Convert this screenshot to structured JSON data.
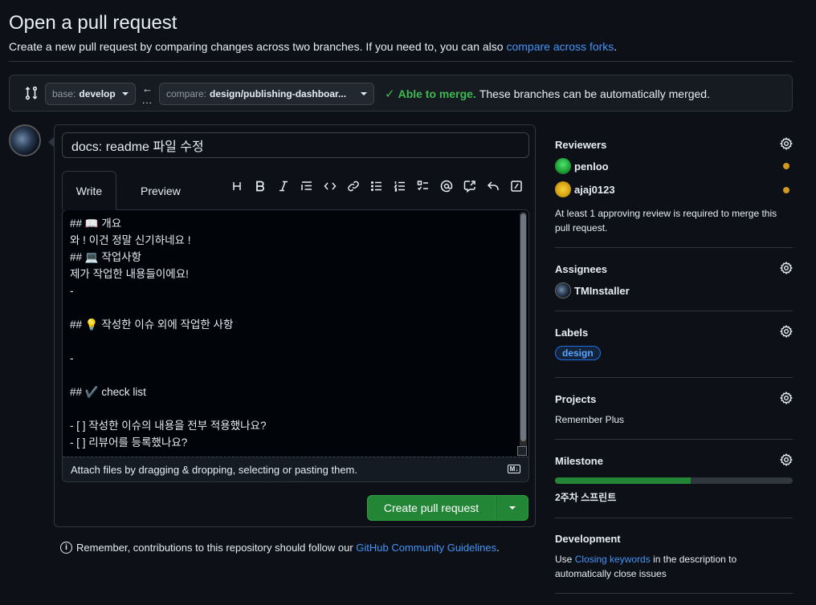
{
  "header": {
    "title": "Open a pull request",
    "subtitle": "Create a new pull request by comparing changes across two branches. If you need to, you can also ",
    "subtitle_link": "compare across forks",
    "subtitle_end": "."
  },
  "branches": {
    "base_key": "base:",
    "base_value": "develop",
    "compare_key": "compare:",
    "compare_value": "design/publishing-dashboar...",
    "arrow": "←",
    "dots": "...",
    "merge_ok": "Able to merge.",
    "merge_text": "These branches can be automatically merged."
  },
  "form": {
    "title_value": "docs: readme 파일 수정",
    "tabs": {
      "write": "Write",
      "preview": "Preview"
    },
    "body": "## 📖 개요\n와 ! 이건 정말 신기하네요 !\n## 💻 작업사항\n제가 작업한 내용들이에요!\n-\n\n## 💡 작성한 이슈 외에 작업한 사항\n\n-\n\n## ✔️ check list\n\n- [ ] 작성한 이슈의 내용을 전부 적용했나요?\n- [ ] 리뷰어를 등록했나요?",
    "attach_text": "Attach files by dragging & dropping, selecting or pasting them.",
    "create_label": "Create pull request"
  },
  "guidelines": {
    "prefix": "Remember, contributions to this repository should follow our ",
    "link": "GitHub Community Guidelines",
    "suffix": "."
  },
  "sidebar": {
    "reviewers": {
      "heading": "Reviewers",
      "items": [
        {
          "name": "penloo",
          "status_color": "#d29922"
        },
        {
          "name": "ajaj0123",
          "status_color": "#d29922"
        }
      ],
      "note": "At least 1 approving review is required to merge this pull request."
    },
    "assignees": {
      "heading": "Assignees",
      "name": "TMInstaller"
    },
    "labels": {
      "heading": "Labels",
      "label": "design"
    },
    "projects": {
      "heading": "Projects",
      "value": "Remember Plus"
    },
    "milestone": {
      "heading": "Milestone",
      "progress": 0.57,
      "name": "2주차 스프린트"
    },
    "development": {
      "heading": "Development",
      "prefix": "Use ",
      "link": "Closing keywords",
      "suffix": " in the description to automatically close issues"
    }
  },
  "colors": {
    "accent": "#4493f8",
    "success": "#3fb950",
    "button": "#238636",
    "pending": "#d29922"
  }
}
